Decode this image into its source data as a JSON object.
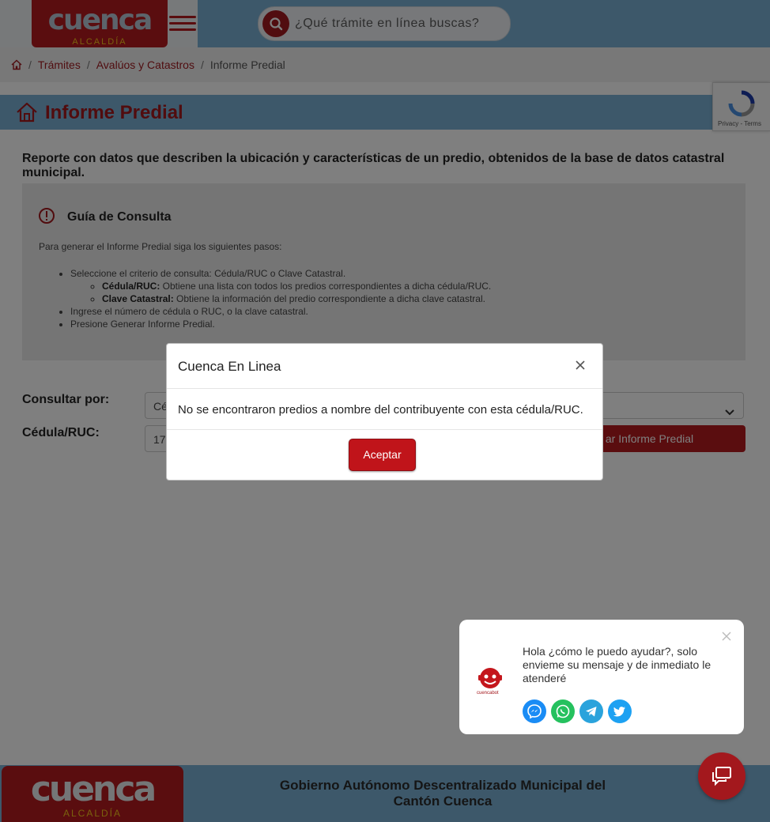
{
  "header": {
    "logo_word": "cuenca",
    "logo_sub": "ALCALDÍA",
    "search_placeholder": "¿Qué trámite en línea buscas?"
  },
  "breadcrumb": {
    "items": [
      "Trámites",
      "Avalúos y Catastros"
    ],
    "current": "Informe Predial"
  },
  "recaptcha": {
    "text": "Privacy - Terms"
  },
  "page": {
    "title": "Informe Predial",
    "intro": "Reporte con datos que describen la ubicación y características de un predio, obtenidos de la base de datos catastral municipal."
  },
  "guide": {
    "title": "Guía de Consulta",
    "paragraph": "Para generar el Informe Predial siga los siguientes pasos:",
    "step1": "Seleccione el criterio de consulta: Cédula/RUC o Clave Catastral.",
    "sub1_label": "Cédula/RUC:",
    "sub1_text": " Obtiene una lista con todos los predios correspondientes a dicha cédula/RUC.",
    "sub2_label": "Clave Catastral:",
    "sub2_text": " Obtiene la información del predio correspondiente a dicha clave catastral.",
    "step2": "Ingrese el número de cédula o RUC, o la clave catastral.",
    "step3": "Presione Generar Informe Predial."
  },
  "form": {
    "consultar_label": "Consultar por:",
    "consultar_value": "Cé",
    "cedula_label": "Cédula/RUC:",
    "cedula_value": "17",
    "generate_label": "ar Informe Predial"
  },
  "modal": {
    "title": "Cuenca En Linea",
    "body": "No se encontraron predios a nombre del contribuyente con esta cédula/RUC.",
    "button": "Aceptar"
  },
  "chat": {
    "message": "Hola ¿cómo le puedo ayudar?, solo envieme su mensaje y de inmediato le atenderé",
    "bot_label": "cuencabot",
    "social": [
      "messenger-icon",
      "whatsapp-icon",
      "telegram-icon",
      "twitter-icon"
    ]
  },
  "footer": {
    "logo_word": "cuenca",
    "logo_sub": "ALCALDÍA",
    "line1": "Gobierno Autónomo Descentralizado Municipal del",
    "line2": "Cantón Cuenca"
  },
  "colors": {
    "brand_red": "#b41a1f",
    "header_blue": "#7ab0d4",
    "accent_gold": "#f5c21a"
  }
}
